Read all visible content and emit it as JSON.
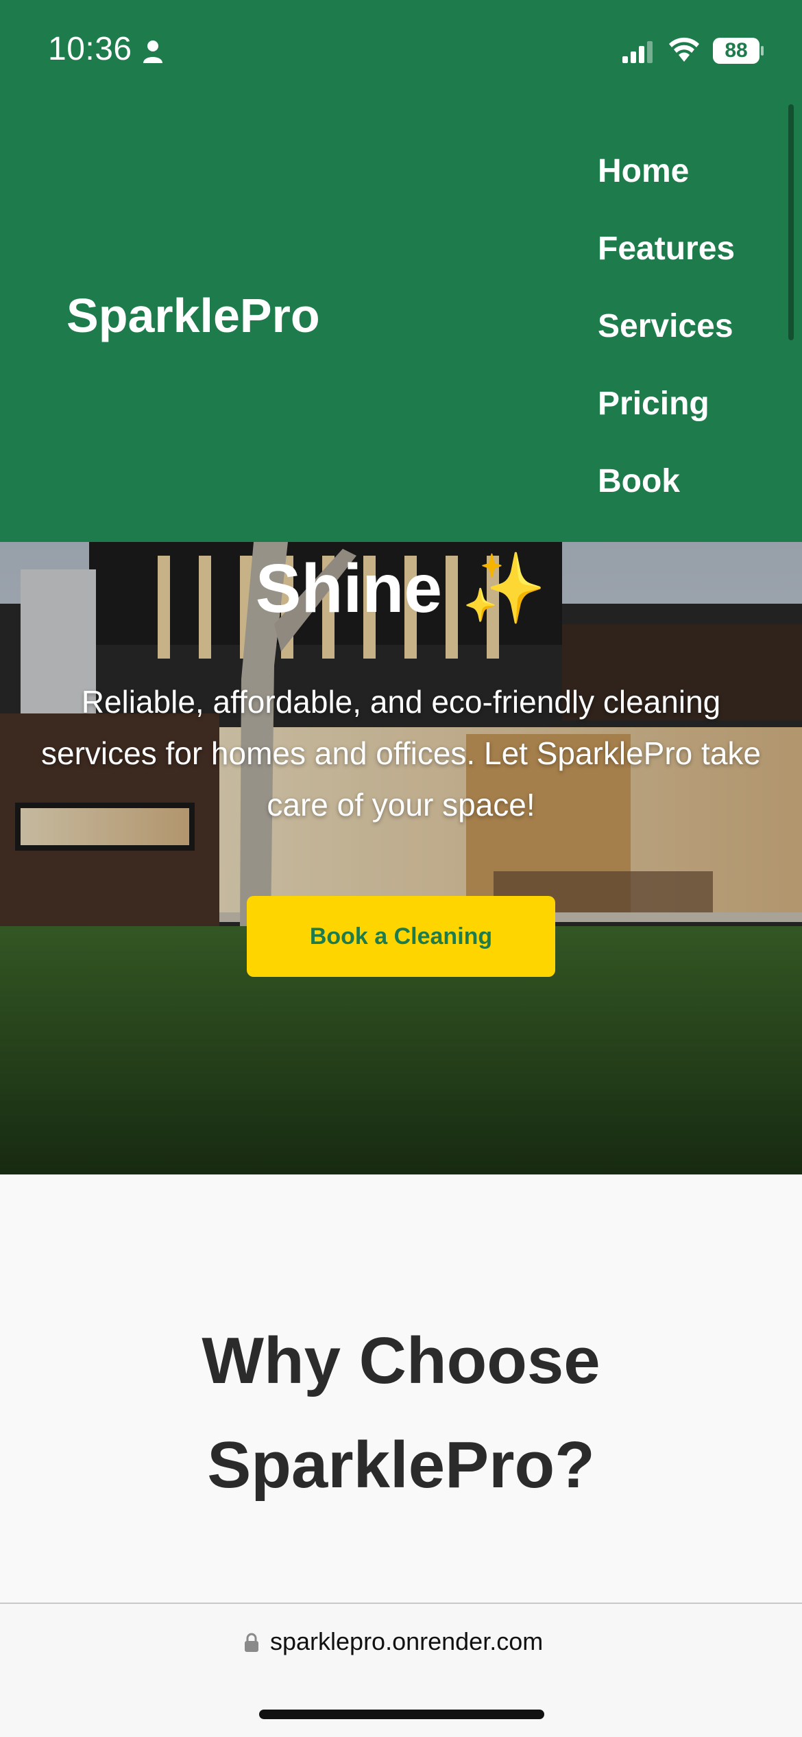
{
  "status_bar": {
    "time": "10:36",
    "battery": "88",
    "icons": [
      "person-icon",
      "signal-icon",
      "wifi-icon",
      "battery-icon"
    ]
  },
  "header": {
    "brand": "SparklePro",
    "nav": [
      "Home",
      "Features",
      "Services",
      "Pricing",
      "Book"
    ],
    "background_color": "#1e7b4b"
  },
  "hero": {
    "title": "Shine ✨",
    "subtitle": "Reliable, affordable, and eco-friendly cleaning services for homes and offices. Let SparklePro take care of your space!",
    "cta_label": "Book a Cleaning",
    "cta_color": "#ffd500"
  },
  "why": {
    "title": "Why Choose SparklePro?"
  },
  "browser": {
    "url": "sparklepro.onrender.com",
    "icons": [
      "lock-icon"
    ]
  }
}
